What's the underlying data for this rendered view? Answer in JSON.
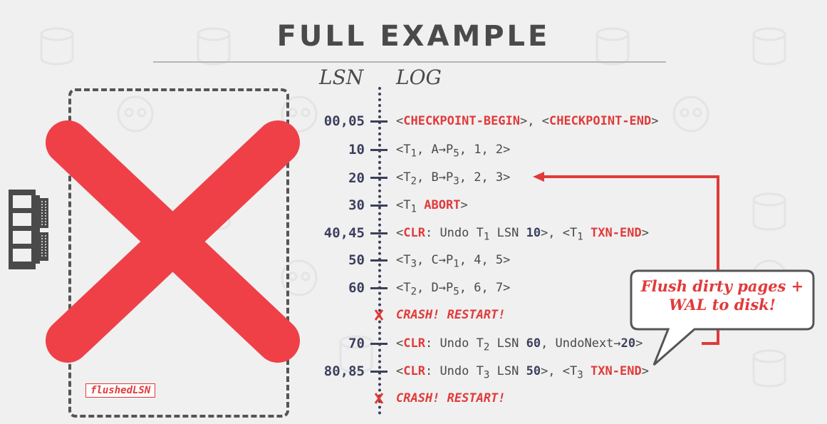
{
  "title": "FULL EXAMPLE",
  "headers": {
    "lsn": "LSN",
    "log": "LOG"
  },
  "colors": {
    "accent": "#e13a3a",
    "dark": "#3b3f5c",
    "text": "#4a4a4a"
  },
  "icons": {
    "memory": "ram-chip-icon",
    "cross": "big-red-x-icon"
  },
  "rows": [
    {
      "lsn": "00,05",
      "parts": [
        "<",
        "CHECKPOINT-BEGIN",
        ">, <",
        "CHECKPOINT-END",
        ">"
      ]
    },
    {
      "lsn": "10",
      "parts": [
        "<T",
        "1",
        ", A→P",
        "5",
        ", 1, 2>"
      ]
    },
    {
      "lsn": "20",
      "parts": [
        "<T",
        "2",
        ", B→P",
        "3",
        ", 2, 3>"
      ]
    },
    {
      "lsn": "30",
      "parts": [
        "<T",
        "1",
        " ",
        "ABORT",
        ">"
      ]
    },
    {
      "lsn": "40,45",
      "parts": [
        "<",
        "CLR",
        ": Undo T",
        "1",
        " LSN ",
        "10",
        ">, <T",
        "1",
        " ",
        "TXN-END",
        ">"
      ]
    },
    {
      "lsn": "50",
      "parts": [
        "<T",
        "3",
        ", C→P",
        "1",
        ", 4, 5>"
      ]
    },
    {
      "lsn": "60",
      "parts": [
        "<T",
        "2",
        ", D→P",
        "5",
        ", 6, 7>"
      ]
    },
    {
      "crash": "CRASH! RESTART!"
    },
    {
      "lsn": "70",
      "parts": [
        "<",
        "CLR",
        ": Undo T",
        "2",
        " LSN ",
        "60",
        ", UndoNext",
        "→",
        "20",
        ">"
      ]
    },
    {
      "lsn": "80,85",
      "parts": [
        "<",
        "CLR",
        ": Undo T",
        "3",
        " LSN ",
        "50",
        ">, <T",
        "3",
        " ",
        "TXN-END",
        ">"
      ]
    },
    {
      "crash": "CRASH! RESTART!"
    }
  ],
  "flushed_label": "flushedLSN",
  "callout": {
    "line1": "Flush dirty pages +",
    "line2": "WAL to disk!"
  }
}
